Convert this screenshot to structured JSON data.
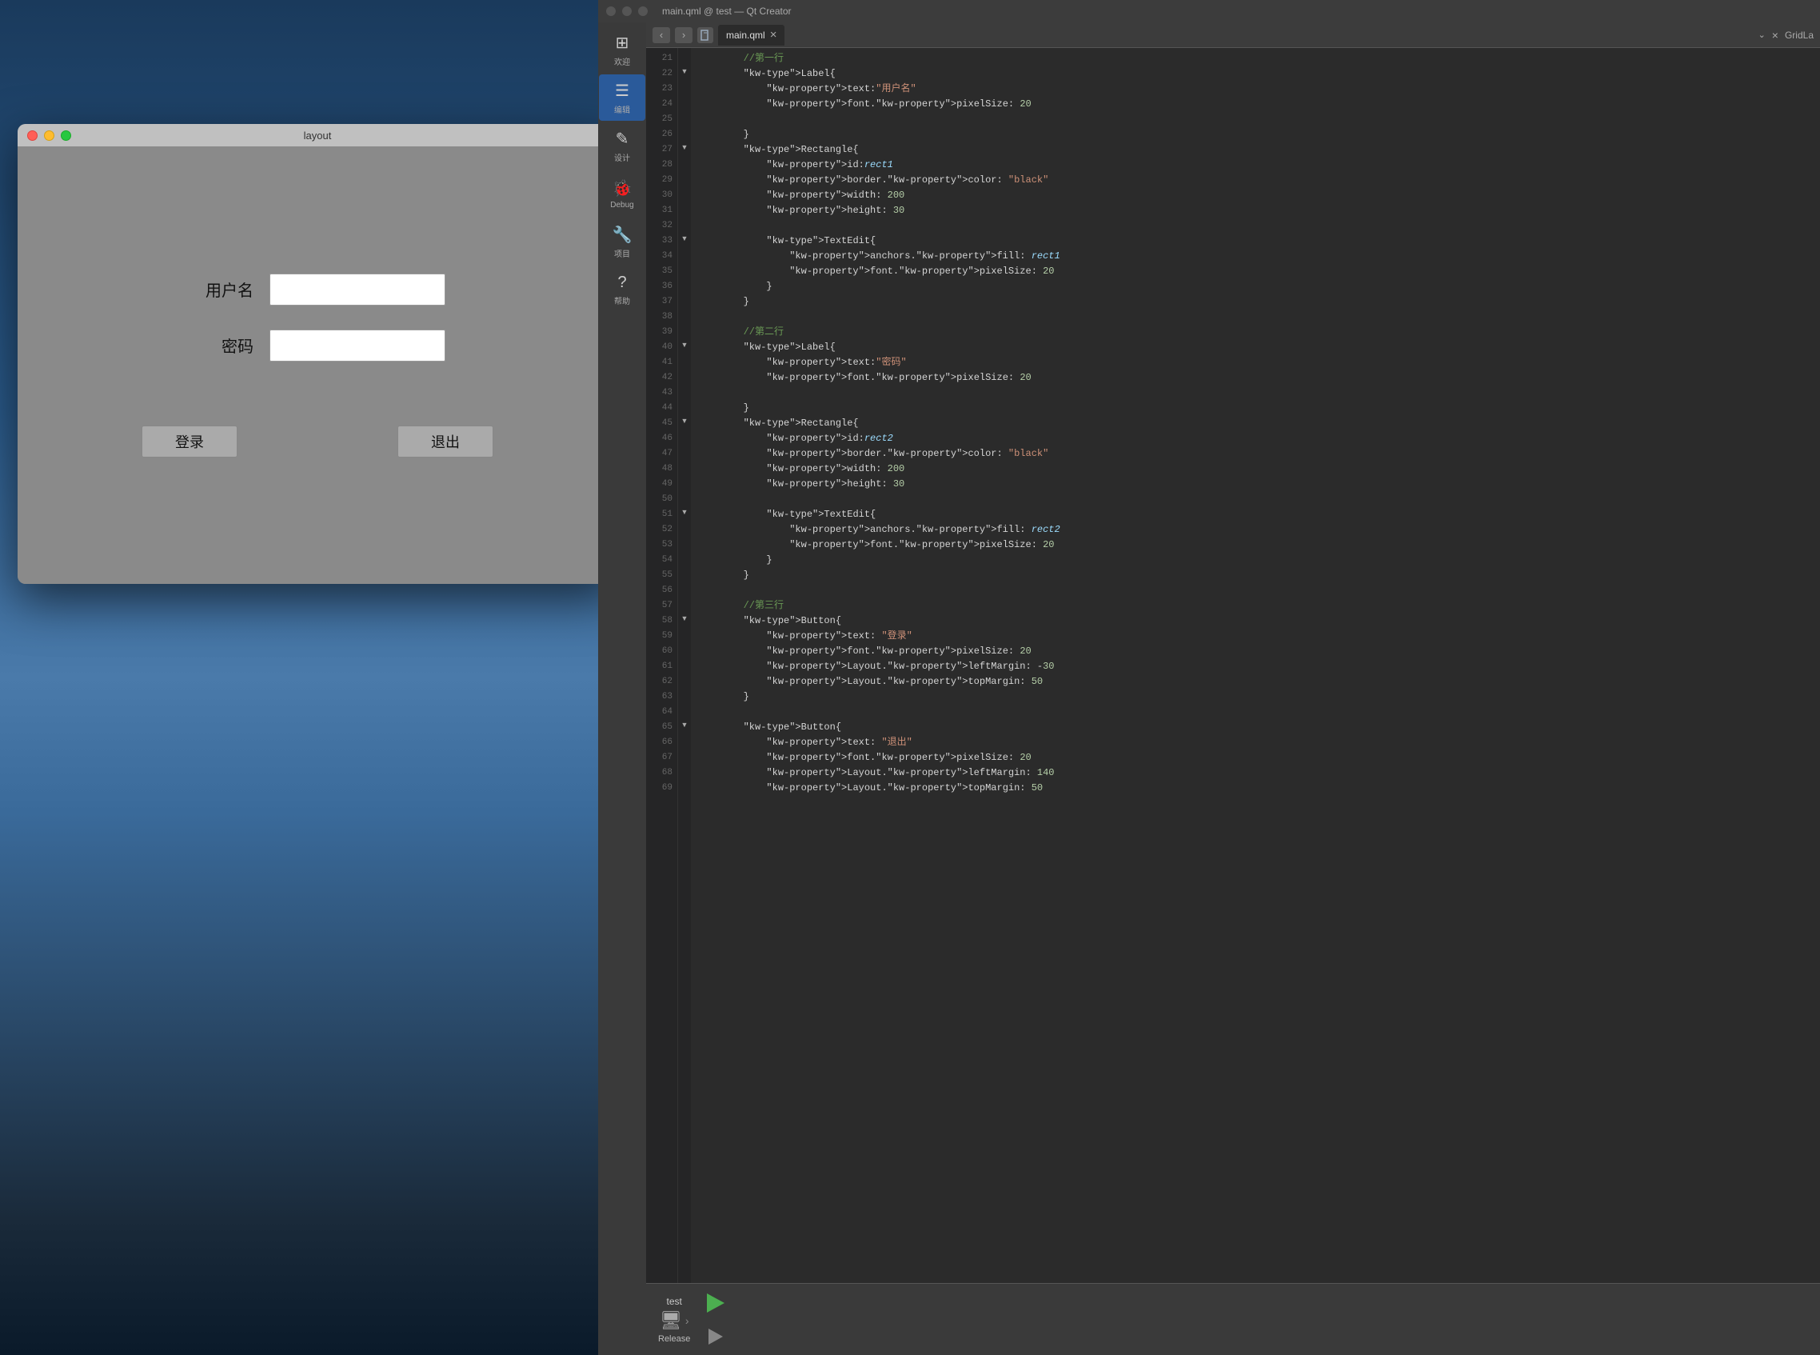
{
  "window": {
    "title": "layout",
    "qt_title": "main.qml @ test — Qt Creator",
    "tab_label": "main.qml",
    "right_tab": "GridLa"
  },
  "sidebar": {
    "items": [
      {
        "icon": "⊞",
        "label": "欢迎"
      },
      {
        "icon": "≡",
        "label": "编辑",
        "active": true
      },
      {
        "icon": "✏",
        "label": "设计"
      },
      {
        "icon": "🐛",
        "label": "Debug"
      },
      {
        "icon": "🔧",
        "label": "项目"
      },
      {
        "icon": "?",
        "label": "帮助"
      }
    ]
  },
  "form": {
    "username_label": "用户名",
    "password_label": "密码",
    "login_button": "登录",
    "exit_button": "退出"
  },
  "build": {
    "target_label": "test",
    "mode_label": "Release"
  },
  "code": {
    "lines": [
      {
        "num": 21,
        "content": "        //第一行",
        "type": "comment"
      },
      {
        "num": 22,
        "content": "        Label{",
        "type": "code",
        "fold": true
      },
      {
        "num": 23,
        "content": "            text:\"用户名\"",
        "type": "code"
      },
      {
        "num": 24,
        "content": "            font.pixelSize: 20",
        "type": "code"
      },
      {
        "num": 25,
        "content": "",
        "type": "code"
      },
      {
        "num": 26,
        "content": "        }",
        "type": "code"
      },
      {
        "num": 27,
        "content": "        Rectangle{",
        "type": "code",
        "fold": true
      },
      {
        "num": 28,
        "content": "            id:rect1",
        "type": "code"
      },
      {
        "num": 29,
        "content": "            border.color: \"black\"",
        "type": "code"
      },
      {
        "num": 30,
        "content": "            width: 200",
        "type": "code"
      },
      {
        "num": 31,
        "content": "            height: 30",
        "type": "code"
      },
      {
        "num": 32,
        "content": "",
        "type": "code"
      },
      {
        "num": 33,
        "content": "            TextEdit{",
        "type": "code",
        "fold": true
      },
      {
        "num": 34,
        "content": "                anchors.fill: rect1",
        "type": "code"
      },
      {
        "num": 35,
        "content": "                font.pixelSize: 20",
        "type": "code"
      },
      {
        "num": 36,
        "content": "            }",
        "type": "code"
      },
      {
        "num": 37,
        "content": "        }",
        "type": "code"
      },
      {
        "num": 38,
        "content": "",
        "type": "code"
      },
      {
        "num": 39,
        "content": "        //第二行",
        "type": "comment"
      },
      {
        "num": 40,
        "content": "        Label{",
        "type": "code",
        "fold": true
      },
      {
        "num": 41,
        "content": "            text:\"密码\"",
        "type": "code"
      },
      {
        "num": 42,
        "content": "            font.pixelSize: 20",
        "type": "code"
      },
      {
        "num": 43,
        "content": "",
        "type": "code"
      },
      {
        "num": 44,
        "content": "        }",
        "type": "code"
      },
      {
        "num": 45,
        "content": "        Rectangle{",
        "type": "code",
        "fold": true
      },
      {
        "num": 46,
        "content": "            id:rect2",
        "type": "code"
      },
      {
        "num": 47,
        "content": "            border.color: \"black\"",
        "type": "code"
      },
      {
        "num": 48,
        "content": "            width: 200",
        "type": "code"
      },
      {
        "num": 49,
        "content": "            height: 30",
        "type": "code"
      },
      {
        "num": 50,
        "content": "",
        "type": "code"
      },
      {
        "num": 51,
        "content": "            TextEdit{",
        "type": "code",
        "fold": true
      },
      {
        "num": 52,
        "content": "                anchors.fill: rect2",
        "type": "code"
      },
      {
        "num": 53,
        "content": "                font.pixelSize: 20",
        "type": "code"
      },
      {
        "num": 54,
        "content": "            }",
        "type": "code"
      },
      {
        "num": 55,
        "content": "        }",
        "type": "code"
      },
      {
        "num": 56,
        "content": "",
        "type": "code"
      },
      {
        "num": 57,
        "content": "        //第三行",
        "type": "comment"
      },
      {
        "num": 58,
        "content": "        Button{",
        "type": "code",
        "fold": true
      },
      {
        "num": 59,
        "content": "            text: \"登录\"",
        "type": "code"
      },
      {
        "num": 60,
        "content": "            font.pixelSize: 20",
        "type": "code"
      },
      {
        "num": 61,
        "content": "            Layout.leftMargin: -30",
        "type": "code"
      },
      {
        "num": 62,
        "content": "            Layout.topMargin: 50",
        "type": "code"
      },
      {
        "num": 63,
        "content": "        }",
        "type": "code"
      },
      {
        "num": 64,
        "content": "",
        "type": "code"
      },
      {
        "num": 65,
        "content": "        Button{",
        "type": "code",
        "fold": true
      },
      {
        "num": 66,
        "content": "            text: \"退出\"",
        "type": "code"
      },
      {
        "num": 67,
        "content": "            font.pixelSize: 20",
        "type": "code"
      },
      {
        "num": 68,
        "content": "            Layout.leftMargin: 140",
        "type": "code"
      },
      {
        "num": 69,
        "content": "            Layout.topMargin: 50",
        "type": "code"
      }
    ]
  }
}
